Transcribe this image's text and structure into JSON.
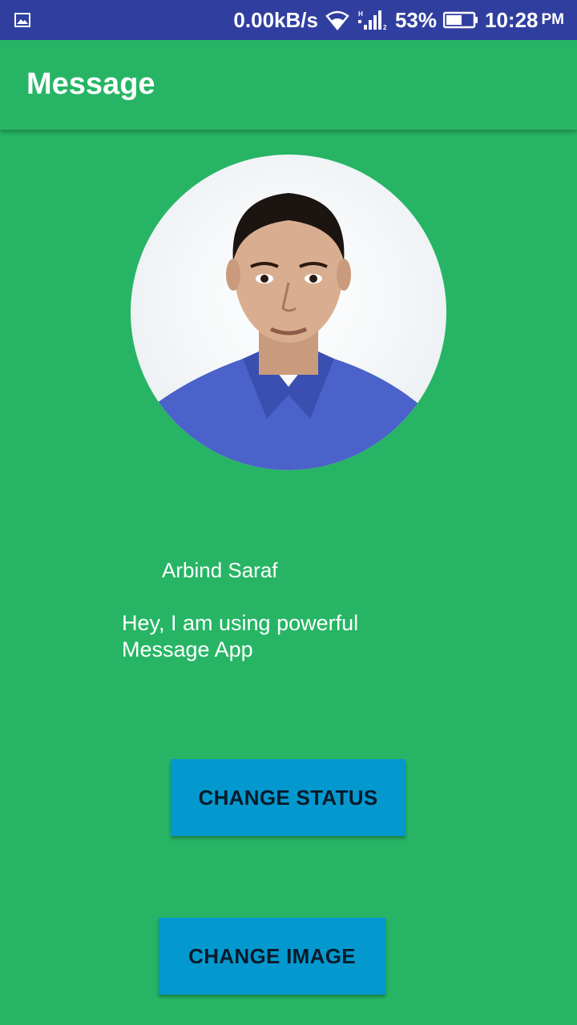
{
  "status_bar": {
    "speed": "0.00kB/s",
    "battery": "53%",
    "time": "10:28",
    "ampm": "PM",
    "icons": [
      "gallery-icon",
      "wifi-icon",
      "signal-icon",
      "battery-icon"
    ]
  },
  "app_bar": {
    "title": "Message"
  },
  "profile": {
    "name": "Arbind Saraf",
    "status": "Hey, I am using powerful Message App"
  },
  "buttons": {
    "change_status": "CHANGE STATUS",
    "change_image": "CHANGE IMAGE"
  },
  "colors": {
    "status_bar": "#303f9f",
    "primary": "#27b565",
    "button": "#0399cf"
  }
}
